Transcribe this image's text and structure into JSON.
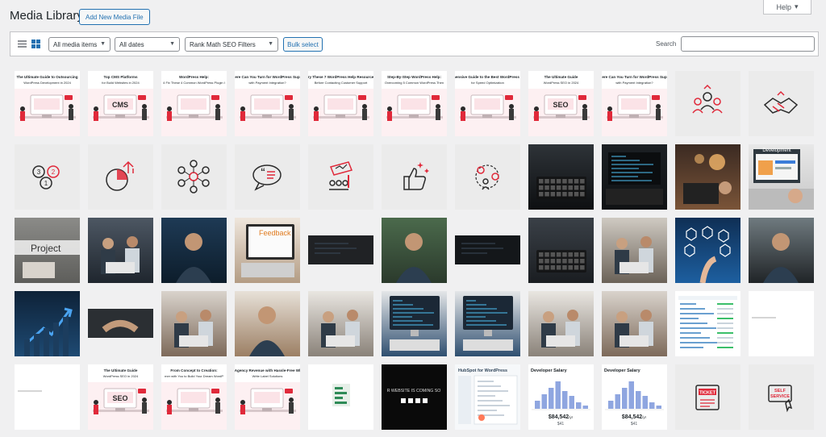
{
  "header": {
    "title": "Media Library",
    "add_new_label": "Add New Media File",
    "help_label": "Help"
  },
  "toolbar": {
    "filters": [
      "All media items",
      "All dates",
      "Rank Math SEO Filters"
    ],
    "bulk_label": "Bulk select",
    "search_label": "Search",
    "search_value": ""
  },
  "colors": {
    "accent": "#2271b1",
    "brand_red": "#e0293a",
    "pink_bg": "#fbe3e7",
    "icon_tile_bg": "#ebebeb"
  },
  "grid": {
    "rows": [
      [
        {
          "kind": "banner",
          "title": "The Ultimate Guide to Outsourcing",
          "subtitle": "WordPress Development in 2024"
        },
        {
          "kind": "banner",
          "title": "Top CMS Platforms",
          "subtitle": "for Build Websites in 2024",
          "label": "CMS"
        },
        {
          "kind": "banner",
          "title": "WordPress Help:",
          "subtitle": "4 Fix These 4 Common WordPress Plugin I"
        },
        {
          "kind": "banner",
          "title": "here Can You Turn for WordPress Supp",
          "subtitle": "with Payment Integration?"
        },
        {
          "kind": "banner",
          "title": "Try These 7 WordPress Help Resources",
          "subtitle": "Before Contacting Customer Support"
        },
        {
          "kind": "banner",
          "title": "Step-By-Step WordPress Help:",
          "subtitle": "Overcoming 5 Common WordPress Then"
        },
        {
          "kind": "banner",
          "title": "ehensive Guide to the Best WordPress Pl",
          "subtitle": "for Speed Optimization"
        },
        {
          "kind": "banner",
          "title": "The Ultimate Guide",
          "subtitle": "WordPress SEO in 2024",
          "label": "SEO"
        },
        {
          "kind": "banner",
          "title": "here Can You Turn for WordPress Supp",
          "subtitle": "with Payment Integration?"
        },
        {
          "kind": "icon",
          "icon": "team-icon"
        },
        {
          "kind": "icon",
          "icon": "handshake-icon"
        }
      ],
      [
        {
          "kind": "icon",
          "icon": "numbered-bubbles-icon"
        },
        {
          "kind": "icon",
          "icon": "pie-growth-icon"
        },
        {
          "kind": "icon",
          "icon": "network-people-icon"
        },
        {
          "kind": "icon",
          "icon": "quote-bubble-icon"
        },
        {
          "kind": "icon",
          "icon": "graph-people-icon"
        },
        {
          "kind": "icon",
          "icon": "thumbs-up-icon"
        },
        {
          "kind": "icon",
          "icon": "gears-person-icon"
        },
        {
          "kind": "photo",
          "photo": "keyboard-dark-photo"
        },
        {
          "kind": "photo",
          "photo": "code-screen-photo"
        },
        {
          "kind": "photo",
          "photo": "laptop-evening-photo"
        },
        {
          "kind": "photo",
          "photo": "development-laptop-photo",
          "label": "Development"
        }
      ],
      [
        {
          "kind": "photo",
          "photo": "project-notebook-photo",
          "label": "Project"
        },
        {
          "kind": "photo",
          "photo": "team-meeting-photo"
        },
        {
          "kind": "photo",
          "photo": "thinking-man-photo"
        },
        {
          "kind": "photo",
          "photo": "feedback-laptop-photo",
          "label": "Feedback"
        },
        {
          "kind": "photo",
          "photo": "blurred-code-photo"
        },
        {
          "kind": "photo",
          "photo": "developer-glasses-photo"
        },
        {
          "kind": "photo",
          "photo": "code-strip-photo"
        },
        {
          "kind": "photo",
          "photo": "laptop-typing-photo"
        },
        {
          "kind": "photo",
          "photo": "office-desk-photo"
        },
        {
          "kind": "photo",
          "photo": "hand-network-photo"
        },
        {
          "kind": "photo",
          "photo": "businessman-check-photo"
        }
      ],
      [
        {
          "kind": "photo",
          "photo": "growth-arrow-photo"
        },
        {
          "kind": "photo",
          "photo": "handshake-photo"
        },
        {
          "kind": "photo",
          "photo": "team-group-photo"
        },
        {
          "kind": "photo",
          "photo": "woman-office-photo"
        },
        {
          "kind": "photo",
          "photo": "team-laptop-photo"
        },
        {
          "kind": "photo",
          "photo": "monitor-code-photo"
        },
        {
          "kind": "photo",
          "photo": "monitor-code-photo-2"
        },
        {
          "kind": "photo",
          "photo": "team-laptop-photo-2"
        },
        {
          "kind": "photo",
          "photo": "team-group-photo-2"
        },
        {
          "kind": "screen",
          "screen": "wp-table-screenshot"
        },
        {
          "kind": "screen",
          "screen": "blank-screenshot"
        }
      ],
      [
        {
          "kind": "screen",
          "screen": "blank-screenshot-2"
        },
        {
          "kind": "banner",
          "title": "The Ultimate Guide",
          "subtitle": "WordPress SEO in 2024",
          "label": "SEO"
        },
        {
          "kind": "banner",
          "title": "From Concept to Creation:",
          "subtitle": "rner with You to Build Your Dream WordP"
        },
        {
          "kind": "banner",
          "title": "r Agency Revenue with Hassle-Free Whi",
          "subtitle": "Write Label Solutions"
        },
        {
          "kind": "screen",
          "screen": "green-bars-screenshot"
        },
        {
          "kind": "coming",
          "text": "R WEBSITE IS COMING SO"
        },
        {
          "kind": "hubspot",
          "title": "HubSpot for WordPress"
        },
        {
          "kind": "salary",
          "title": "Developer Salary",
          "value": "$84,542",
          "unit": "/yr",
          "hourly": "$41"
        },
        {
          "kind": "salary",
          "title": "Developer Salary",
          "value": "$84,542",
          "unit": "/yr",
          "hourly": "$41"
        },
        {
          "kind": "icon",
          "icon": "ticket-icon",
          "label": "TICKET"
        },
        {
          "kind": "icon",
          "icon": "self-service-icon",
          "label": "SELF SERVICE"
        }
      ]
    ]
  }
}
